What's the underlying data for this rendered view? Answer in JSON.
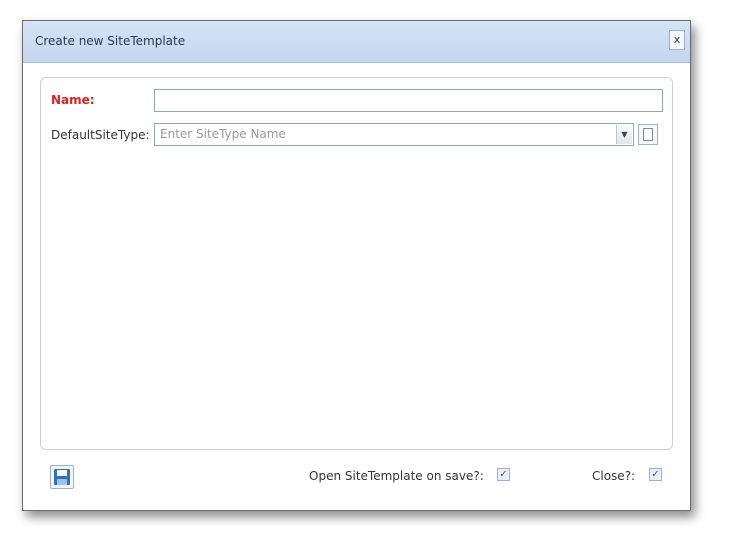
{
  "dialog": {
    "title": "Create new SiteTemplate",
    "close_label": "x"
  },
  "form": {
    "name_label": "Name:",
    "name_value": "",
    "type_label": "DefaultSiteType:",
    "type_placeholder": "Enter SiteType Name",
    "dropdown_icon": "triangle-down-icon",
    "browse_icon": "document-icon"
  },
  "footer": {
    "save_icon": "floppy-disk-icon",
    "open_on_save_label": "Open SiteTemplate on save?:",
    "open_on_save_checked": true,
    "close_label": "Close?:",
    "close_checked": true
  },
  "colors": {
    "title_bar": "#c3d6ef",
    "required_label": "#e02020",
    "save_icon": "#2f6fc4"
  }
}
